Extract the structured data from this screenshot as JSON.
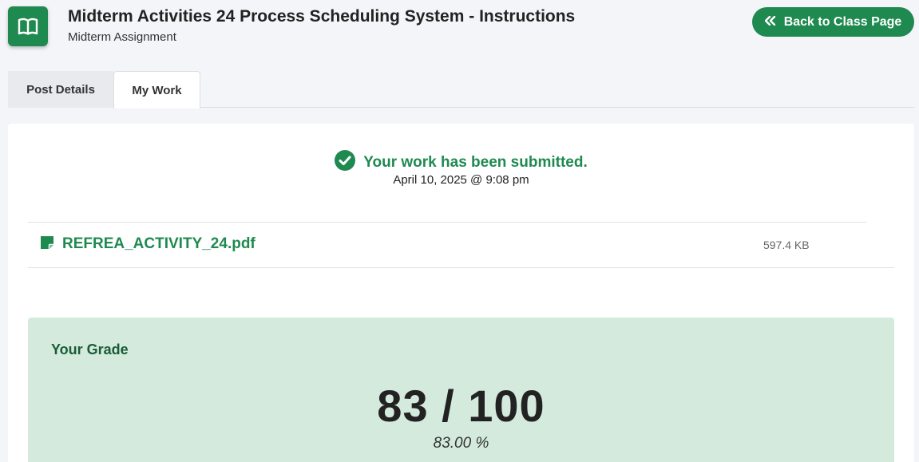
{
  "header": {
    "title": "Midterm Activities 24 Process Scheduling System - Instructions",
    "subtitle": "Midterm Assignment",
    "back_button_label": "Back to Class Page",
    "icon": "open-book-icon"
  },
  "tabs": [
    {
      "label": "Post Details",
      "active": false
    },
    {
      "label": "My Work",
      "active": true
    }
  ],
  "submission": {
    "status": "Your work has been submitted.",
    "date": "April 10, 2025 @ 9:08 pm",
    "status_icon": "check-circle-icon"
  },
  "file": {
    "name": "REFREA_ACTIVITY_24.pdf",
    "size": "597.4 KB",
    "icon": "file-icon"
  },
  "grade": {
    "label": "Your Grade",
    "score": "83 / 100",
    "percent": "83.00 %"
  },
  "colors": {
    "accent": "#1f8a50",
    "grade_bg": "#d3eadc",
    "page_bg": "#f4f5f9"
  }
}
